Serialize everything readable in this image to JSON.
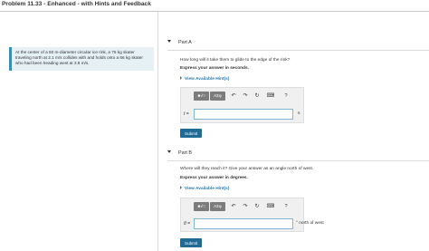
{
  "page": {
    "title": "Problem 11.33 - Enhanced - with Hints and Feedback"
  },
  "problem": {
    "text": "At the center of a 50 m-diameter circular ice rink, a 75 kg skater traveling north at 2.1 m/s collides with and holds onto a 66 kg skater who had been heading west at 3.8 m/s."
  },
  "toolbar": {
    "sqrt_label": "■√□",
    "greek_label": "AΣφ",
    "undo_icon": "↶",
    "redo_icon": "↷",
    "reset_icon": "↻",
    "keyboard_icon": "⌨",
    "help_icon": "?"
  },
  "part_a": {
    "header": "Part A",
    "question": "How long will it take them to glide to the edge of the rink?",
    "express": "Express your answer in seconds.",
    "hint_link": "View Available Hint(s)",
    "variable": "t =",
    "input_value": "",
    "unit": "s",
    "submit_label": "Submit"
  },
  "part_b": {
    "header": "Part B",
    "question": "Where will they reach it? Give your answer as an angle north of west.",
    "express": "Express your answer in degrees.",
    "hint_link": "View Available Hint(s)",
    "variable": "θ =",
    "input_value": "",
    "unit": "° north of west",
    "submit_label": "Submit"
  },
  "colors": {
    "accent": "#2a7ab0",
    "submit": "#1f6b96",
    "problem_bg": "#e6f1f6"
  }
}
